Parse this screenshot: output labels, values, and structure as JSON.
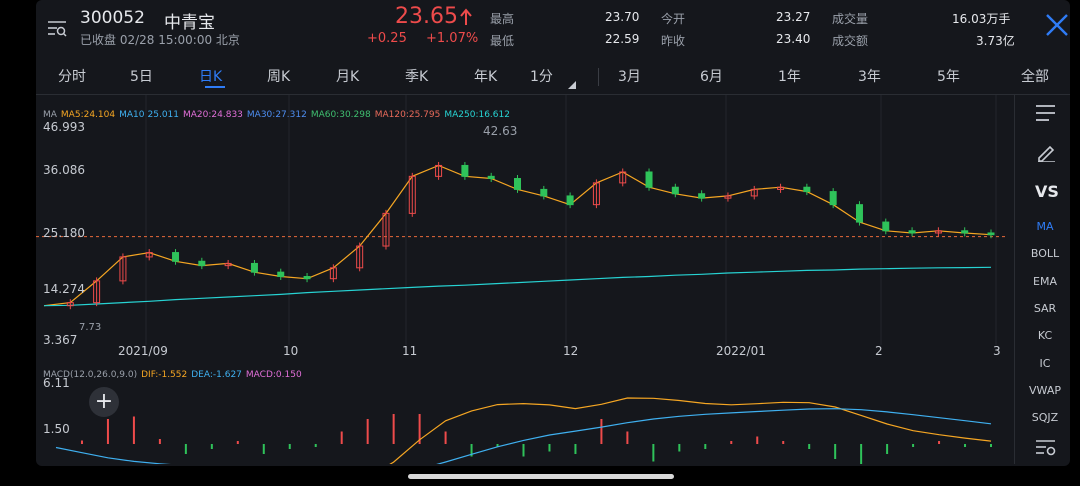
{
  "header": {
    "code": "300052",
    "name": "中青宝",
    "status": "已收盘 02/28 15:00:00 北京",
    "price": "23.65",
    "change": "+0.25",
    "change_pct": "+1.07%",
    "stats": [
      {
        "label": "最高",
        "value": "23.70",
        "color": "#ee4b4b"
      },
      {
        "label": "今开",
        "value": "23.27",
        "color": "#2fc35a"
      },
      {
        "label": "成交量",
        "value": "16.03万手",
        "color": "#e6e8ec"
      },
      {
        "label": "最低",
        "value": "22.59",
        "color": "#2fc35a"
      },
      {
        "label": "昨收",
        "value": "23.40",
        "color": "#e6e8ec"
      },
      {
        "label": "成交额",
        "value": "3.73亿",
        "color": "#e6e8ec"
      }
    ]
  },
  "tabs": [
    "分时",
    "5日",
    "日K",
    "周K",
    "月K",
    "季K",
    "年K",
    "1分",
    "3月",
    "6月",
    "1年",
    "3年",
    "5年",
    "全部"
  ],
  "active_tab": "日K",
  "tools": [
    "MA",
    "BOLL",
    "EMA",
    "SAR",
    "KC",
    "IC",
    "VWAP",
    "SQJZ"
  ],
  "active_tool": "MA",
  "vs_label": "VS",
  "ma_legend": [
    {
      "text": "MA",
      "color": "#9aa0aa"
    },
    {
      "text": "MA5:24.104",
      "color": "#f5a623"
    },
    {
      "text": "MA10:25.011",
      "color": "#3fb0f0"
    },
    {
      "text": "MA20:24.833",
      "color": "#e16fd8"
    },
    {
      "text": "MA30:27.312",
      "color": "#4d8df0"
    },
    {
      "text": "MA60:30.298",
      "color": "#3fbf6f"
    },
    {
      "text": "MA120:25.795",
      "color": "#e86a5a"
    },
    {
      "text": "MA250:16.612",
      "color": "#27d3d3"
    }
  ],
  "macd_legend": [
    {
      "text": "MACD(12.0,26.0,9.0)",
      "color": "#9aa0aa"
    },
    {
      "text": "DIF:-1.552",
      "color": "#f5a623"
    },
    {
      "text": "DEA:-1.627",
      "color": "#3fb0f0"
    },
    {
      "text": "MACD:0.150",
      "color": "#e16fd8"
    }
  ],
  "y_axis": [
    "46.993",
    "36.086",
    "25.180",
    "14.274",
    "3.367"
  ],
  "x_axis": [
    "2021/09",
    "10",
    "11",
    "12",
    "2022/01",
    "2",
    "3"
  ],
  "annotations": {
    "high": "42.63",
    "low": "7.73"
  },
  "macd_axis": [
    "6.11",
    "1.50"
  ],
  "chart_data": {
    "type": "candlestick",
    "title": "",
    "y_range": [
      3.367,
      46.993
    ],
    "dashed_line": 23.65,
    "series": [
      {
        "name": "MA5",
        "values": [
          7.8,
          8.5,
          13.5,
          19,
          20,
          18,
          17,
          17.5,
          15.5,
          14.5,
          14,
          16.5,
          21.5,
          29,
          37.5,
          40,
          37.5,
          37,
          34.5,
          33,
          31,
          36,
          38.5,
          35,
          33.5,
          32.5,
          33,
          34.5,
          35,
          34,
          31,
          27,
          25,
          24.5,
          25,
          24.5,
          24.1
        ]
      },
      {
        "name": "MA250",
        "values": [
          7.8,
          7.9,
          8.2,
          8.5,
          8.8,
          9.2,
          9.5,
          9.8,
          10.1,
          10.4,
          10.8,
          11.1,
          11.4,
          11.7,
          12.0,
          12.3,
          12.5,
          12.8,
          13.1,
          13.4,
          13.7,
          14.0,
          14.3,
          14.5,
          14.8,
          15.0,
          15.3,
          15.5,
          15.7,
          15.9,
          16.0,
          16.2,
          16.3,
          16.4,
          16.5,
          16.55,
          16.61
        ]
      }
    ],
    "x_labels": [
      "2021/09",
      "10",
      "11",
      "12",
      "2022/01",
      "2",
      "3"
    ]
  }
}
